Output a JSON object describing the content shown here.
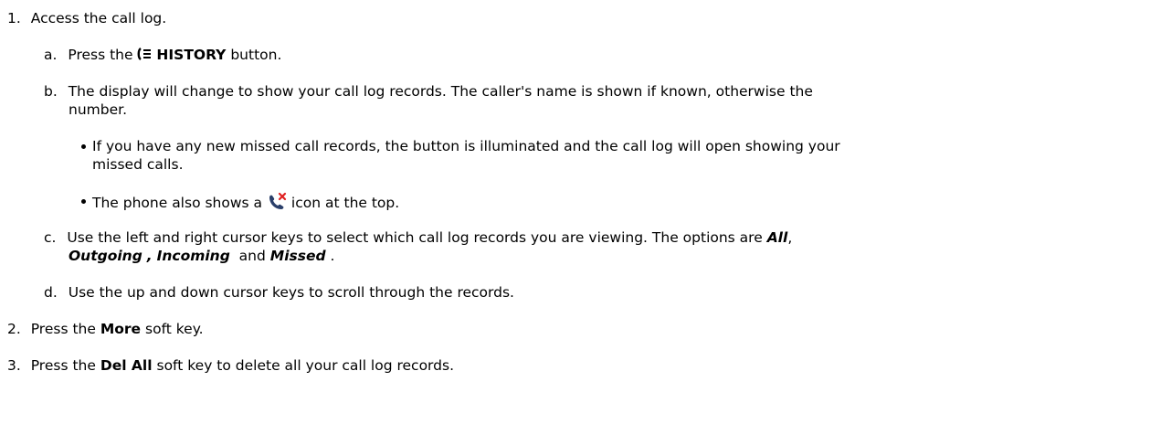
{
  "steps": [
    {
      "number": "1.",
      "text": "Access the call log.",
      "substeps": [
        {
          "letter": "a.",
          "pre": "Press the",
          "icon": "history-icon",
          "bold": "HISTORY",
          "post": "button."
        },
        {
          "letter": "b.",
          "line1": "The display will change to show your call log records. The caller's name is shown if known, otherwise the",
          "line2": "number.",
          "bullets": [
            {
              "line1": "If you have any new missed call records, the button is illuminated and the call log will open showing your",
              "line2": "missed calls."
            },
            {
              "pre": "The phone also shows a",
              "icon": "missed-call-icon",
              "post": "icon at the top."
            }
          ]
        },
        {
          "letter": "c.",
          "line1_pre": "Use the left and right cursor keys to select which call log records you are viewing. The options are",
          "opt_all": "All",
          "comma1": ",",
          "opt_outgoing": "Outgoing",
          "comma2": ",",
          "opt_incoming": "Incoming",
          "and": "and",
          "opt_missed": "Missed",
          "period": "."
        },
        {
          "letter": "d.",
          "text": "Use the up and down cursor keys to scroll through the records."
        }
      ]
    },
    {
      "number": "2.",
      "pre": "Press the",
      "bold": "More",
      "post": "soft key."
    },
    {
      "number": "3.",
      "pre": "Press the",
      "bold": "Del All",
      "post": "soft key to delete all your call log records."
    }
  ],
  "colors": {
    "text": "#000000",
    "missed_x": "#e02020",
    "handset": "#2a3f6a"
  }
}
